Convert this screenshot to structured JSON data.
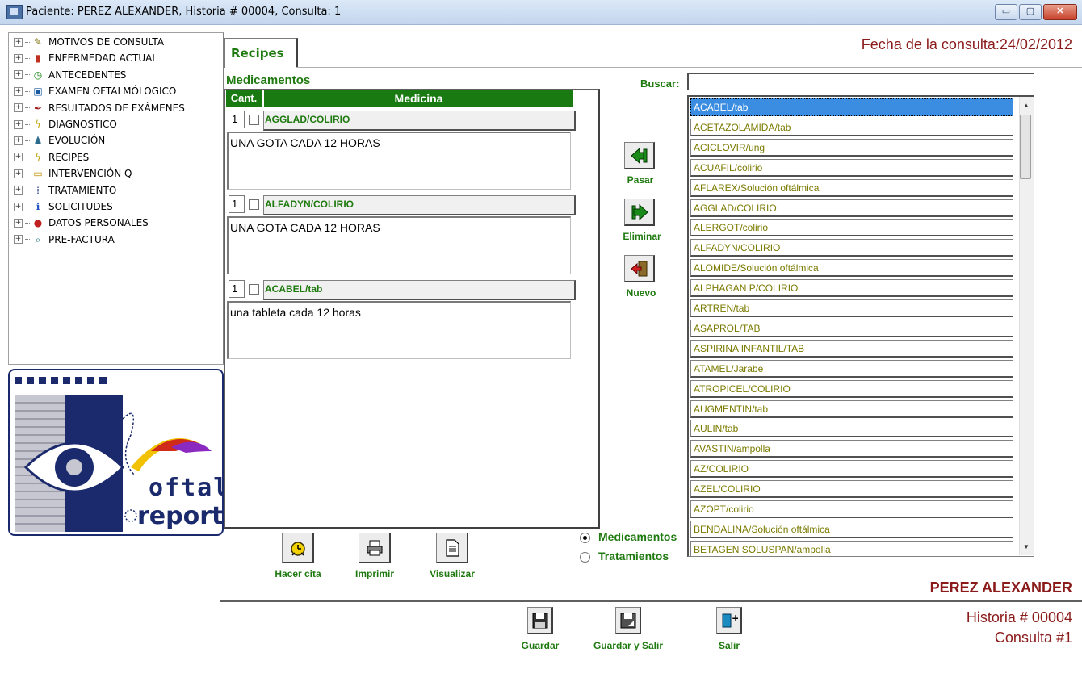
{
  "window": {
    "title": "Paciente: PEREZ ALEXANDER, Historia # 00004, Consulta: 1",
    "min": "▭",
    "max": "▢",
    "close": "✕"
  },
  "tree": {
    "expander": "+",
    "items": [
      {
        "label": "MOTIVOS DE CONSULTA",
        "icon": "pencil-icon",
        "glyph": "✎",
        "color": "#7a6a00"
      },
      {
        "label": "ENFERMEDAD ACTUAL",
        "icon": "bar-chart-icon",
        "glyph": "▮",
        "color": "#c03020"
      },
      {
        "label": "ANTECEDENTES",
        "icon": "clock-icon",
        "glyph": "◷",
        "color": "#1a8a1a"
      },
      {
        "label": "EXAMEN OFTALMÓLOGICO",
        "icon": "monitor-icon",
        "glyph": "▣",
        "color": "#1a5aa0"
      },
      {
        "label": "RESULTADOS DE EXÁMENES",
        "icon": "pen-icon",
        "glyph": "✒",
        "color": "#a02020"
      },
      {
        "label": "DIAGNOSTICO",
        "icon": "lightning-icon",
        "glyph": "ϟ",
        "color": "#c0a000"
      },
      {
        "label": "EVOLUCIÓN",
        "icon": "person-icon",
        "glyph": "♟",
        "color": "#2a6a8a"
      },
      {
        "label": "RECIPES",
        "icon": "lightning-icon",
        "glyph": "ϟ",
        "color": "#c0a000"
      },
      {
        "label": "INTERVENCIÓN Q",
        "icon": "folder-icon",
        "glyph": "▭",
        "color": "#c09000"
      },
      {
        "label": "TRATAMIENTO",
        "icon": "grid-icon",
        "glyph": "⁞",
        "color": "#203080"
      },
      {
        "label": "SOLICITUDES",
        "icon": "info-icon",
        "glyph": "ℹ",
        "color": "#2050c0"
      },
      {
        "label": "DATOS PERSONALES",
        "icon": "apple-icon",
        "glyph": "●",
        "color": "#c02020"
      },
      {
        "label": "PRE-FACTURA",
        "icon": "magnifier-icon",
        "glyph": "⌕",
        "color": "#207070"
      }
    ]
  },
  "logo": {
    "line1": "oftal",
    "line2": "report"
  },
  "tab": {
    "label": "Recipes"
  },
  "fecha": "Fecha de la consulta:24/02/2012",
  "medicamentos": {
    "title": "Medicamentos",
    "header_cant": "Cant.",
    "header_medicina": "Medicina",
    "rows": [
      {
        "qty": "1",
        "name": "AGGLAD/COLIRIO",
        "dose": "UNA GOTA CADA 12 HORAS"
      },
      {
        "qty": "1",
        "name": "ALFADYN/COLIRIO",
        "dose": "UNA GOTA CADA 12 HORAS"
      },
      {
        "qty": "1",
        "name": "ACABEL/tab",
        "dose": "una tableta cada 12 horas"
      }
    ]
  },
  "actions": {
    "pasar": "Pasar",
    "eliminar": "Eliminar",
    "nuevo": "Nuevo"
  },
  "buscar": {
    "label": "Buscar:",
    "value": ""
  },
  "list": {
    "items": [
      "ACABEL/tab",
      "ACETAZOLAMIDA/tab",
      "ACICLOVIR/ung",
      "ACUAFIL/colirio",
      "AFLAREX/Solución oftálmica",
      "AGGLAD/COLIRIO",
      "ALERGOT/colirio",
      "ALFADYN/COLIRIO",
      "ALOMIDE/Solución oftálmica",
      "ALPHAGAN P/COLIRIO",
      "ARTREN/tab",
      "ASAPROL/TAB",
      "ASPIRINA INFANTIL/TAB",
      "ATAMEL/Jarabe",
      "ATROPICEL/COLIRIO",
      "AUGMENTIN/tab",
      "AULIN/tab",
      "AVASTIN/ampolla",
      "AZ/COLIRIO",
      "AZEL/COLIRIO",
      "AZOPT/colirio",
      "BENDALINA/Solución oftálmica",
      "BETAGEN SOLUSPAN/ampolla"
    ],
    "selected_index": 0
  },
  "radio": {
    "medicamentos": "Medicamentos",
    "tratamientos": "Tratamientos",
    "selected": "medicamentos"
  },
  "bottom_buttons": {
    "hacer_cita": "Hacer cita",
    "imprimir": "Imprimir",
    "visualizar": "Visualizar"
  },
  "footer_buttons": {
    "guardar": "Guardar",
    "guardar_salir": "Guardar y Salir",
    "salir": "Salir"
  },
  "patient": {
    "name": "PEREZ ALEXANDER",
    "historia": "Historia # 00004",
    "consulta": "Consulta #1"
  }
}
